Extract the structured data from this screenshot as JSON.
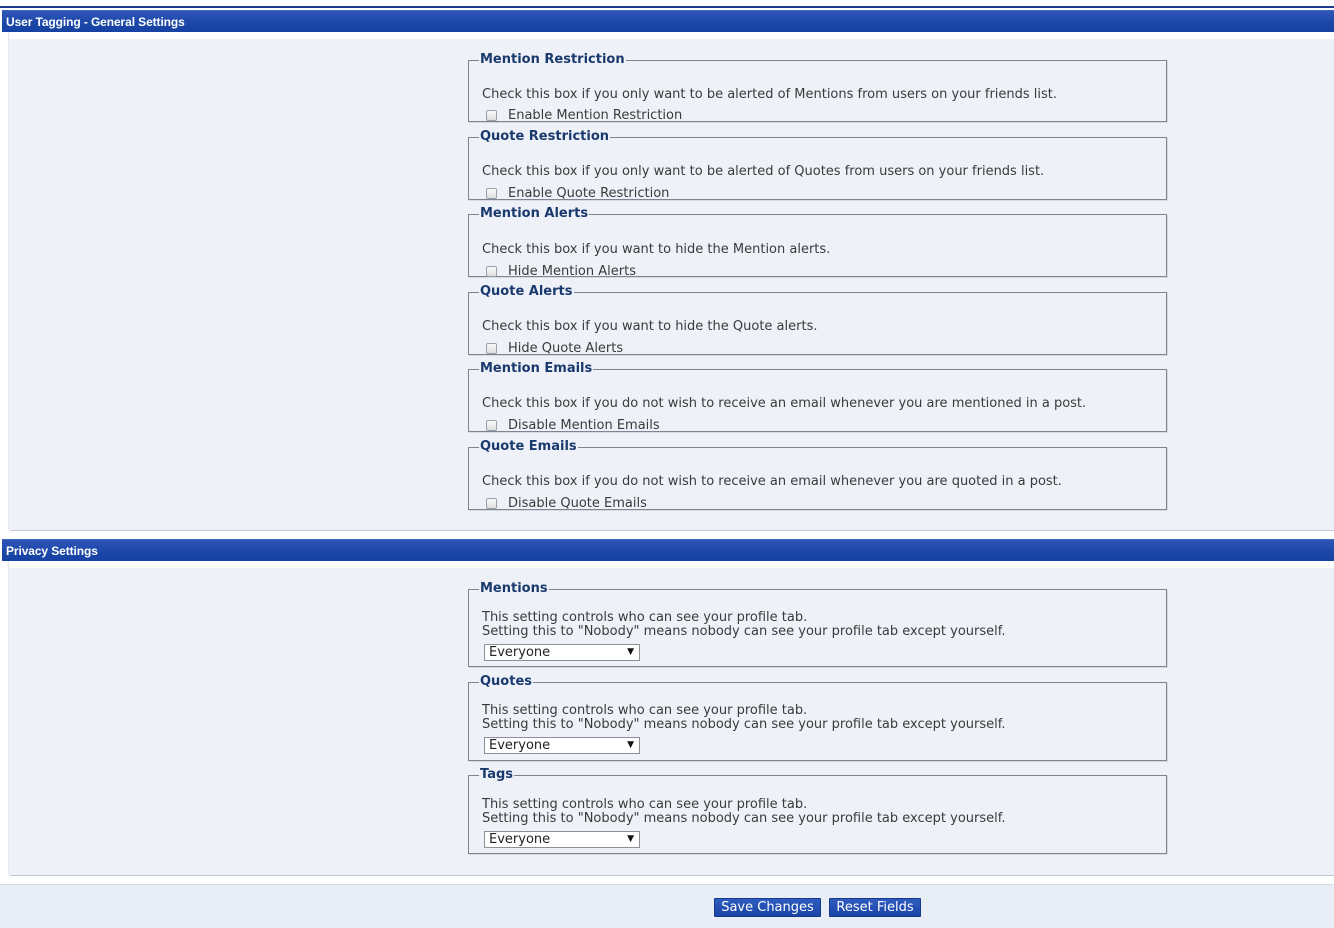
{
  "general_section": {
    "title": "User Tagging - General Settings",
    "options": [
      {
        "legend": "Mention Restriction",
        "description": "Check this box if you only want to be alerted of Mentions from users on your friends list.",
        "checkbox_label": "Enable Mention Restriction",
        "checked": false
      },
      {
        "legend": "Quote Restriction",
        "description": "Check this box if you only want to be alerted of Quotes from users on your friends list.",
        "checkbox_label": "Enable Quote Restriction",
        "checked": false
      },
      {
        "legend": "Mention Alerts",
        "description": "Check this box if you want to hide the Mention alerts.",
        "checkbox_label": "Hide Mention Alerts",
        "checked": false
      },
      {
        "legend": "Quote Alerts",
        "description": "Check this box if you want to hide the Quote alerts.",
        "checkbox_label": "Hide Quote Alerts",
        "checked": false
      },
      {
        "legend": "Mention Emails",
        "description": "Check this box if you do not wish to receive an email whenever you are mentioned in a post.",
        "checkbox_label": "Disable Mention Emails",
        "checked": false
      },
      {
        "legend": "Quote Emails",
        "description": "Check this box if you do not wish to receive an email whenever you are quoted in a post.",
        "checkbox_label": "Disable Quote Emails",
        "checked": false
      }
    ]
  },
  "privacy_section": {
    "title": "Privacy Settings",
    "options": [
      {
        "legend": "Mentions",
        "line1": "This setting controls who can see your profile tab.",
        "line2": "Setting this to \"Nobody\" means nobody can see your profile tab except yourself.",
        "selected": "Everyone"
      },
      {
        "legend": "Quotes",
        "line1": "This setting controls who can see your profile tab.",
        "line2": "Setting this to \"Nobody\" means nobody can see your profile tab except yourself.",
        "selected": "Everyone"
      },
      {
        "legend": "Tags",
        "line1": "This setting controls who can see your profile tab.",
        "line2": "Setting this to \"Nobody\" means nobody can see your profile tab except yourself.",
        "selected": "Everyone"
      }
    ]
  },
  "footer": {
    "save_label": "Save Changes",
    "reset_label": "Reset Fields"
  },
  "icons": {
    "select_arrow": "chevron-down-icon"
  },
  "colors": {
    "header_blue": "#1c48a8",
    "panel_bg": "#eef2f8",
    "legend_text": "#1a3a6e"
  }
}
